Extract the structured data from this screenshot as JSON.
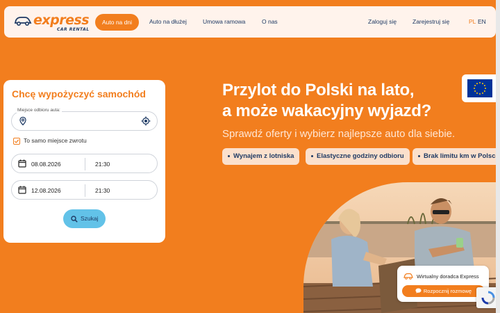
{
  "brand": {
    "name": "express",
    "tagline": "CAR RENTAL"
  },
  "nav": {
    "items": [
      "Auto na dni",
      "Auto na dłużej",
      "Umowa ramowa",
      "O nas"
    ],
    "login": "Zaloguj się",
    "register": "Zarejestruj się",
    "languages": [
      "PL",
      "EN"
    ]
  },
  "booking": {
    "title": "Chcę wypożyczyć samochód",
    "pickup_label": "Miejsce odbioru auta:",
    "pickup_value": "",
    "same_return": "To samo miejsce zwrotu",
    "pickup_date": "08.08.2026",
    "pickup_time": "21:30",
    "return_date": "12.08.2026",
    "return_time": "21:30",
    "search": "Szukaj"
  },
  "hero": {
    "title_line1": "Przylot do Polski na lato,",
    "title_line2": "a może wakacyjny wyjazd?",
    "subtitle": "Sprawdź oferty i wybierz najlepsze auto dla siebie.",
    "pills": [
      "Wynajem z lotniska",
      "Elastyczne godziny odbioru",
      "Brak limitu km w Polsce"
    ]
  },
  "chat": {
    "title": "Wirtualny doradca Express",
    "button": "Rozpocznij rozmowę"
  },
  "colors": {
    "accent": "#f27e1e",
    "navy": "#1e3a64",
    "search": "#62c2e8"
  }
}
